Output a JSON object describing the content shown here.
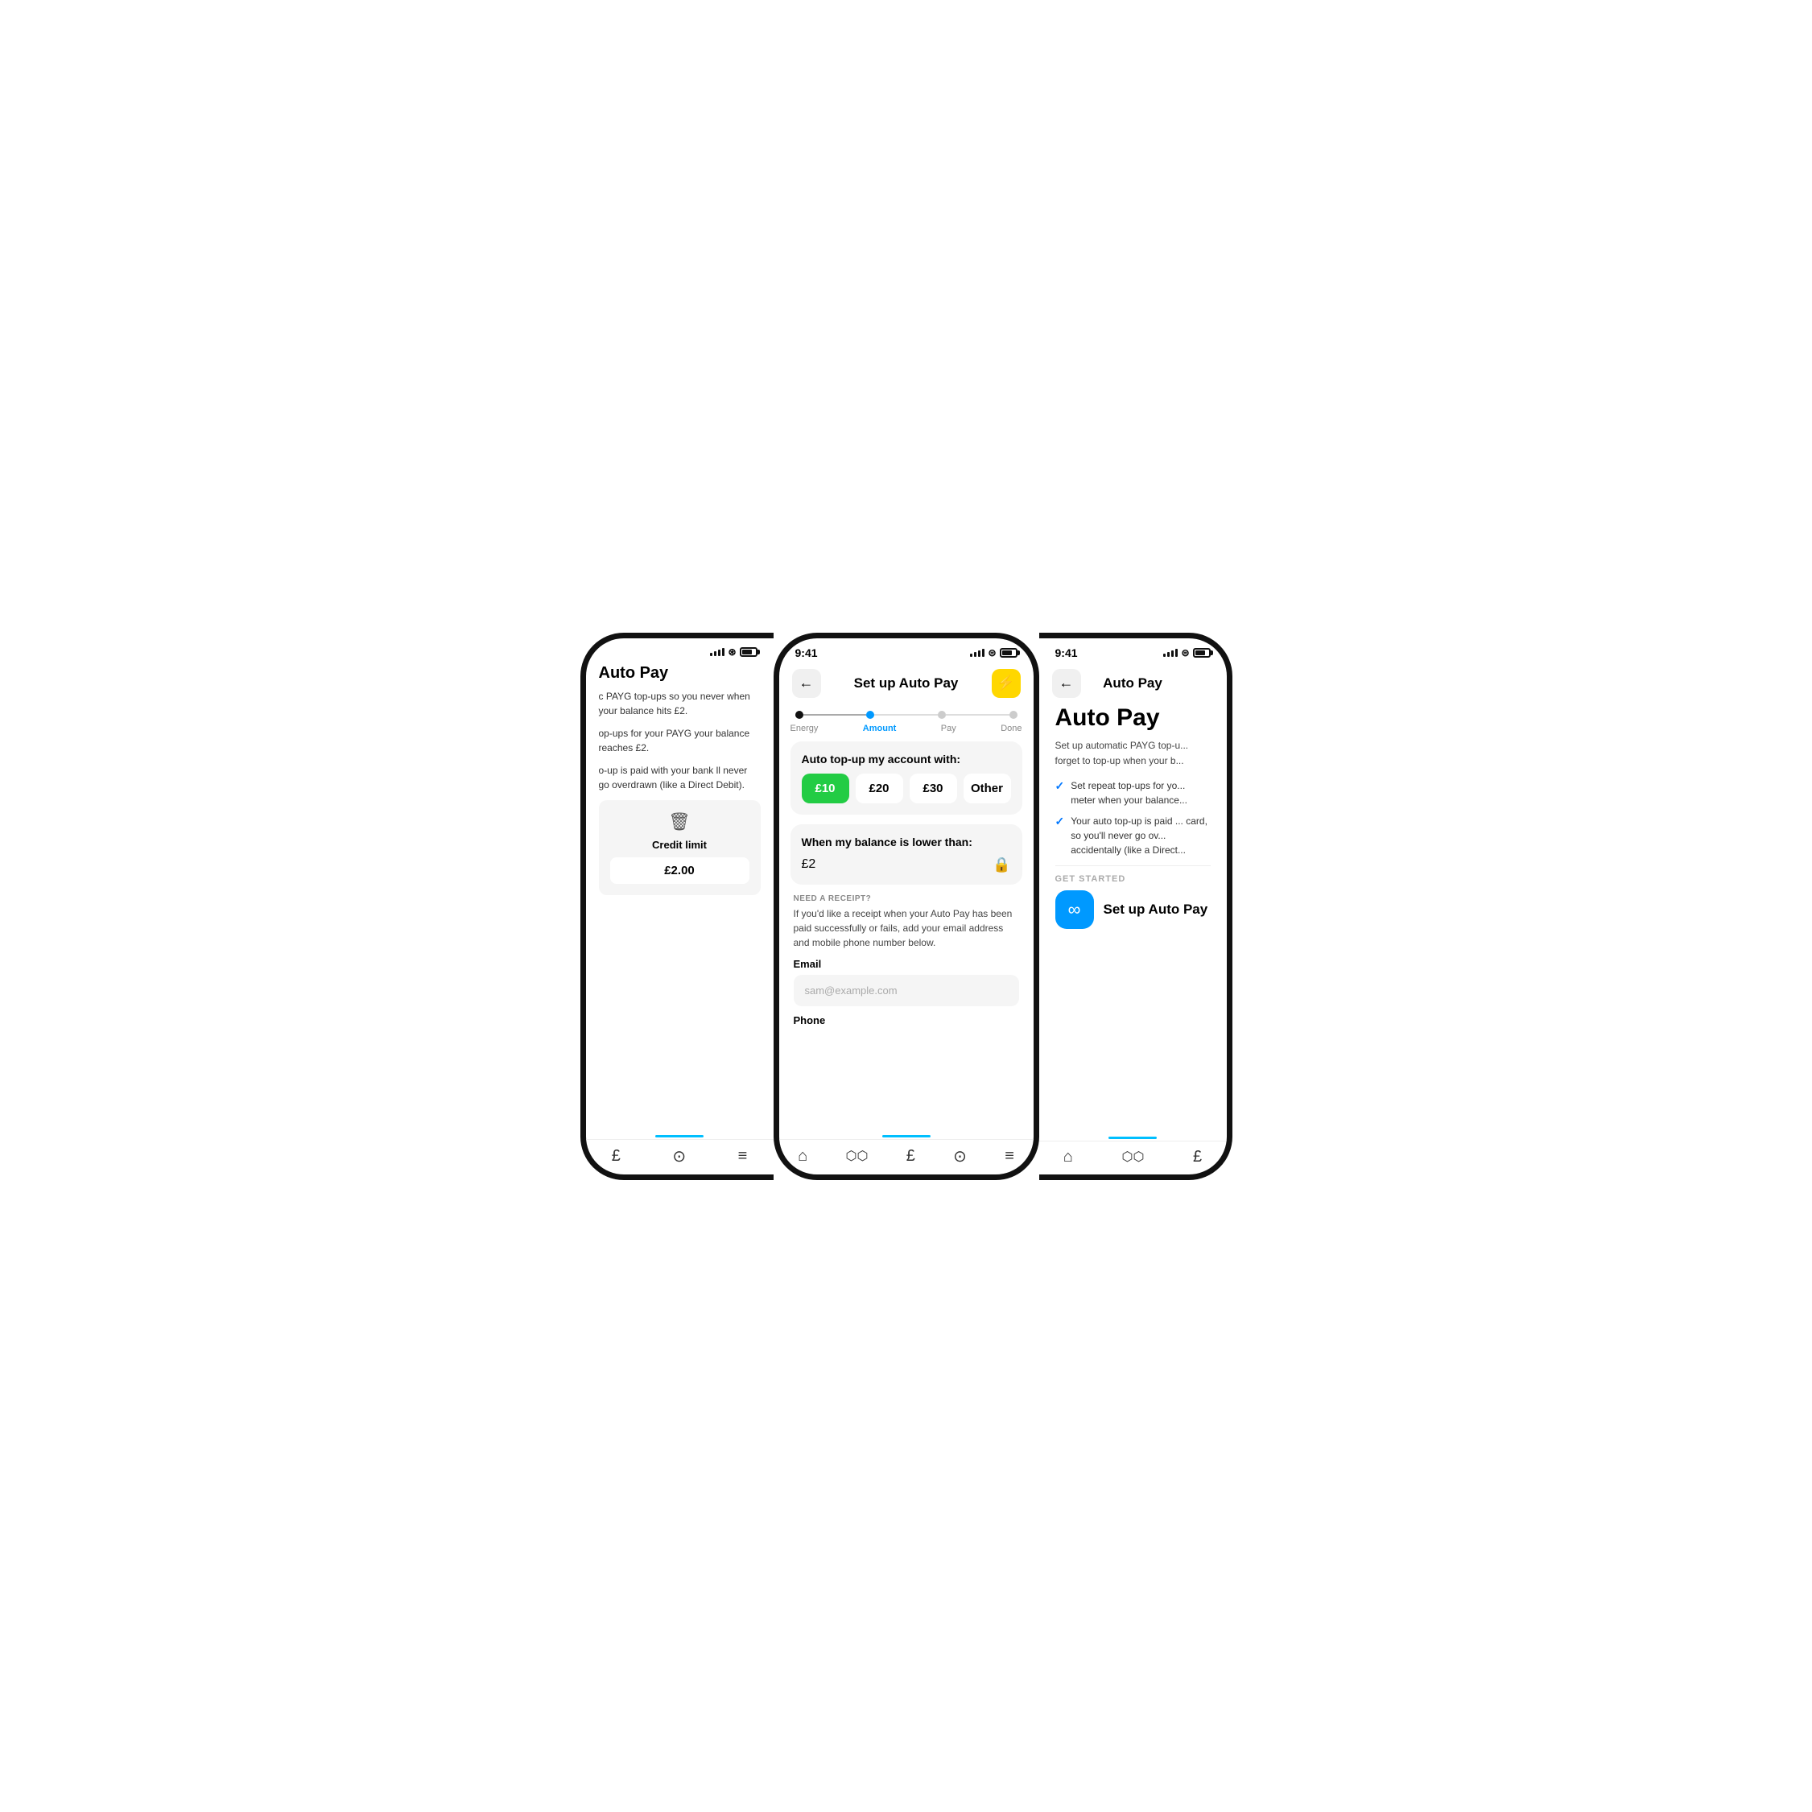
{
  "left": {
    "title": "Auto Pay",
    "desc1": "c PAYG top-ups so you never when your balance hits £2.",
    "desc2": "op-ups for your PAYG your balance reaches £2.",
    "desc3": "o-up is paid with your bank ll never go overdrawn (like a Direct Debit).",
    "delete_label": "Credit limit",
    "credit_value": "£2.00",
    "nav": [
      "£",
      "?",
      "≡"
    ]
  },
  "center": {
    "status_time": "9:41",
    "back_label": "←",
    "title": "Set up Auto Pay",
    "steps": [
      "Energy",
      "Amount",
      "Pay",
      "Done"
    ],
    "active_step": 1,
    "card1_title": "Auto top-up my account with:",
    "amounts": [
      "£10",
      "£20",
      "£30",
      "Other"
    ],
    "selected_amount": 0,
    "card2_title": "When my balance is lower than:",
    "balance_trigger": "£2",
    "receipt_label": "NEED A RECEIPT?",
    "receipt_desc": "If you'd like a receipt when your Auto Pay has been paid successfully or fails, add your email address and mobile phone number below.",
    "email_label": "Email",
    "email_placeholder": "sam@example.com",
    "phone_label": "Phone",
    "nav": [
      "⌂",
      "∿∿",
      "£",
      "?",
      "≡"
    ]
  },
  "right": {
    "status_time": "9:41",
    "back_label": "←",
    "header_title": "Auto Pay",
    "page_title": "Auto Pay",
    "desc": "Set up automatic PAYG top-u... forget to top-up when your b...",
    "checks": [
      "Set repeat top-ups for yo... meter when your balance...",
      "Your auto top-up is paid ... card, so you'll never go ov... accidentally (like a Direct..."
    ],
    "get_started_label": "GET STARTED",
    "setup_btn_label": "Set up Auto Pay",
    "nav": [
      "⌂",
      "∿∿",
      "£"
    ]
  }
}
